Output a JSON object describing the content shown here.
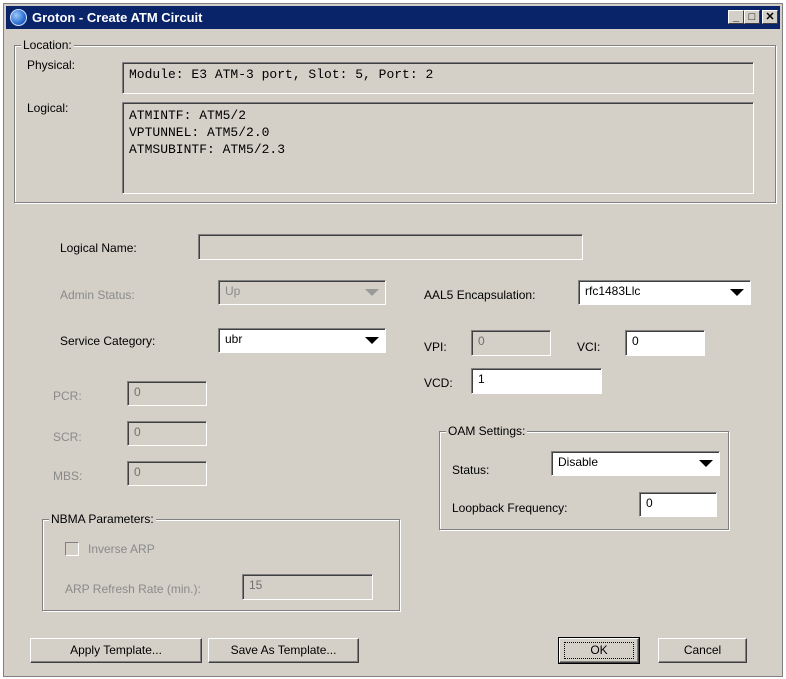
{
  "window": {
    "title": "Groton - Create ATM Circuit",
    "controls": {
      "minimize": "_",
      "maximize": "□",
      "close": "✕"
    }
  },
  "location": {
    "legend": "Location:",
    "physical_label": "Physical:",
    "physical_value": "Module: E3 ATM-3 port, Slot: 5, Port: 2",
    "logical_label": "Logical:",
    "logical_value": "ATMINTF: ATM5/2\nVPTUNNEL: ATM5/2.0\nATMSUBINTF: ATM5/2.3"
  },
  "form": {
    "logical_name_label": "Logical Name:",
    "logical_name_value": "",
    "admin_status_label": "Admin Status:",
    "admin_status_value": "Up",
    "service_category_label": "Service Category:",
    "service_category_value": "ubr",
    "pcr_label": "PCR:",
    "pcr_value": "0",
    "scr_label": "SCR:",
    "scr_value": "0",
    "mbs_label": "MBS:",
    "mbs_value": "0",
    "aal5_label": "AAL5 Encapsulation:",
    "aal5_value": "rfc1483Llc",
    "vpi_label": "VPI:",
    "vpi_value": "0",
    "vci_label": "VCI:",
    "vci_value": "0",
    "vcd_label": "VCD:",
    "vcd_value": "1"
  },
  "nbma": {
    "legend": "NBMA Parameters:",
    "inverse_arp_label": "Inverse ARP",
    "arp_refresh_label": "ARP Refresh Rate (min.):",
    "arp_refresh_value": "15"
  },
  "oam": {
    "legend": "OAM Settings:",
    "status_label": "Status:",
    "status_value": "Disable",
    "loopback_label": "Loopback Frequency:",
    "loopback_value": "0"
  },
  "buttons": {
    "apply_template": "Apply Template...",
    "save_template": "Save As Template...",
    "ok": "OK",
    "cancel": "Cancel"
  }
}
